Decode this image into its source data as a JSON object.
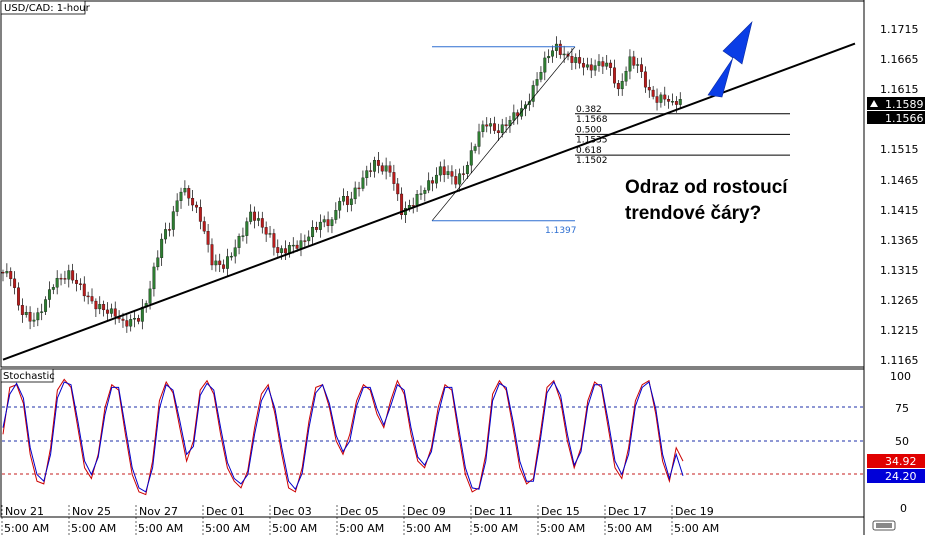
{
  "chart_data": [
    {
      "type": "candlestick",
      "title": "USD/CAD: 1-hour",
      "ylim": [
        1.1165,
        1.1745
      ],
      "y_ticks": [
        "1.1715",
        "1.1665",
        "1.1615",
        "1.1565",
        "1.1515",
        "1.1465",
        "1.1415",
        "1.1365",
        "1.1315",
        "1.1265",
        "1.1215",
        "1.1165"
      ],
      "x_dates": [
        "Nov 21",
        "Nov 25",
        "Nov 27",
        "Dec 01",
        "Dec 03",
        "Dec 05",
        "Dec 09",
        "Dec 11",
        "Dec 15",
        "Dec 17",
        "Dec 19"
      ],
      "x_times": [
        "5:00 AM",
        "5:00 AM",
        "5:00 AM",
        "5:00 AM",
        "5:00 AM",
        "5:00 AM",
        "5:00 AM",
        "5:00 AM",
        "5:00 AM",
        "5:00 AM",
        "5:00 AM"
      ],
      "price_path": [
        [
          0,
          1.1315
        ],
        [
          3,
          1.131
        ],
        [
          5,
          1.1258
        ],
        [
          8,
          1.1238
        ],
        [
          10,
          1.1245
        ],
        [
          14,
          1.1298
        ],
        [
          18,
          1.1312
        ],
        [
          21,
          1.129
        ],
        [
          24,
          1.1265
        ],
        [
          27,
          1.1255
        ],
        [
          30,
          1.1248
        ],
        [
          32,
          1.1232
        ],
        [
          36,
          1.1242
        ],
        [
          38,
          1.1268
        ],
        [
          40,
          1.132
        ],
        [
          42,
          1.137
        ],
        [
          44,
          1.139
        ],
        [
          47,
          1.145
        ],
        [
          49,
          1.1435
        ],
        [
          52,
          1.14
        ],
        [
          55,
          1.133
        ],
        [
          58,
          1.1325
        ],
        [
          60,
          1.1345
        ],
        [
          63,
          1.138
        ],
        [
          65,
          1.141
        ],
        [
          67,
          1.1395
        ],
        [
          70,
          1.137
        ],
        [
          72,
          1.1345
        ],
        [
          75,
          1.1355
        ],
        [
          78,
          1.136
        ],
        [
          80,
          1.1375
        ],
        [
          83,
          1.1395
        ],
        [
          86,
          1.1395
        ],
        [
          88,
          1.1435
        ],
        [
          90,
          1.1425
        ],
        [
          93,
          1.1455
        ],
        [
          95,
          1.1475
        ],
        [
          97,
          1.149
        ],
        [
          99,
          1.148
        ],
        [
          101,
          1.1478
        ],
        [
          102,
          1.1455
        ],
        [
          104,
          1.141
        ],
        [
          106,
          1.142
        ],
        [
          108,
          1.1435
        ],
        [
          110,
          1.145
        ],
        [
          112,
          1.1462
        ],
        [
          114,
          1.148
        ],
        [
          116,
          1.1472
        ],
        [
          118,
          1.146
        ],
        [
          120,
          1.1475
        ],
        [
          122,
          1.1505
        ],
        [
          124,
          1.154
        ],
        [
          126,
          1.1555
        ],
        [
          128,
          1.154
        ],
        [
          130,
          1.1545
        ],
        [
          132,
          1.156
        ],
        [
          134,
          1.157
        ],
        [
          136,
          1.158
        ],
        [
          138,
          1.161
        ],
        [
          140,
          1.164
        ],
        [
          142,
          1.1665
        ],
        [
          144,
          1.1675
        ],
        [
          146,
          1.166
        ],
        [
          148,
          1.1655
        ],
        [
          150,
          1.165
        ],
        [
          152,
          1.164
        ],
        [
          154,
          1.1645
        ],
        [
          156,
          1.165
        ],
        [
          158,
          1.164
        ],
        [
          160,
          1.16
        ],
        [
          161,
          1.1625
        ],
        [
          163,
          1.1655
        ],
        [
          165,
          1.1645
        ],
        [
          166,
          1.163
        ],
        [
          168,
          1.16
        ],
        [
          170,
          1.159
        ],
        [
          172,
          1.1595
        ],
        [
          174,
          1.1582
        ],
        [
          175,
          1.1589
        ]
      ],
      "current_price": "1.1589",
      "bid_price": "1.1566",
      "trendline": {
        "from": [
          0,
          1.1175
        ],
        "to": [
          200,
          1.1677
        ]
      },
      "fib_swing": {
        "low": 1.1397,
        "high": 1.1675,
        "low_label": "1.1397"
      },
      "fib_levels": [
        {
          "ratio": "0.382",
          "price": "1.1568",
          "value": 1.1568
        },
        {
          "ratio": "0.500",
          "price": "1.1535",
          "value": 1.1535
        },
        {
          "ratio": "0.618",
          "price": "1.1502",
          "value": 1.1502
        }
      ],
      "annotation": [
        "Odraz od rostoucí",
        "trendové čáry?"
      ]
    },
    {
      "type": "line",
      "title": "Stochastic",
      "ylim": [
        0,
        100
      ],
      "y_ticks": [
        "100",
        "75",
        "50",
        "25",
        "0"
      ],
      "reference_levels": [
        75,
        50,
        25
      ],
      "k_value": "34.92",
      "d_value": "24.20",
      "series": [
        {
          "color": "#cc0000",
          "values": [
            55,
            90,
            92,
            78,
            40,
            20,
            18,
            45,
            88,
            96,
            90,
            60,
            30,
            22,
            40,
            75,
            92,
            88,
            55,
            25,
            12,
            10,
            35,
            80,
            94,
            86,
            60,
            35,
            50,
            88,
            95,
            85,
            55,
            30,
            20,
            15,
            28,
            60,
            85,
            92,
            70,
            40,
            15,
            12,
            30,
            65,
            90,
            92,
            75,
            50,
            40,
            55,
            80,
            92,
            88,
            70,
            60,
            80,
            95,
            85,
            55,
            35,
            30,
            45,
            75,
            92,
            88,
            55,
            25,
            12,
            15,
            40,
            85,
            95,
            88,
            60,
            30,
            18,
            22,
            55,
            90,
            95,
            80,
            50,
            30,
            45,
            80,
            94,
            90,
            60,
            30,
            22,
            45,
            80,
            92,
            95,
            70,
            35,
            20,
            45,
            35
          ]
        },
        {
          "color": "#0000cc",
          "values": [
            60,
            85,
            93,
            82,
            45,
            25,
            20,
            40,
            82,
            94,
            92,
            65,
            35,
            25,
            38,
            70,
            90,
            90,
            60,
            30,
            15,
            12,
            30,
            74,
            92,
            88,
            65,
            40,
            46,
            84,
            93,
            88,
            60,
            34,
            22,
            18,
            25,
            55,
            80,
            90,
            74,
            45,
            20,
            14,
            26,
            60,
            86,
            92,
            78,
            54,
            42,
            50,
            76,
            90,
            90,
            74,
            62,
            76,
            92,
            88,
            60,
            38,
            32,
            42,
            70,
            90,
            90,
            60,
            30,
            15,
            14,
            35,
            80,
            93,
            90,
            65,
            35,
            20,
            20,
            50,
            86,
            94,
            84,
            55,
            32,
            42,
            76,
            92,
            92,
            65,
            35,
            25,
            40,
            76,
            90,
            94,
            74,
            40,
            22,
            40,
            24
          ]
        }
      ]
    }
  ],
  "colors": {
    "up_candle": "#2e7d32",
    "down_candle": "#b71c1c",
    "arrow": "#0a3de6",
    "fib_swing_line": "#2e6fd1",
    "trendline": "#000000"
  }
}
